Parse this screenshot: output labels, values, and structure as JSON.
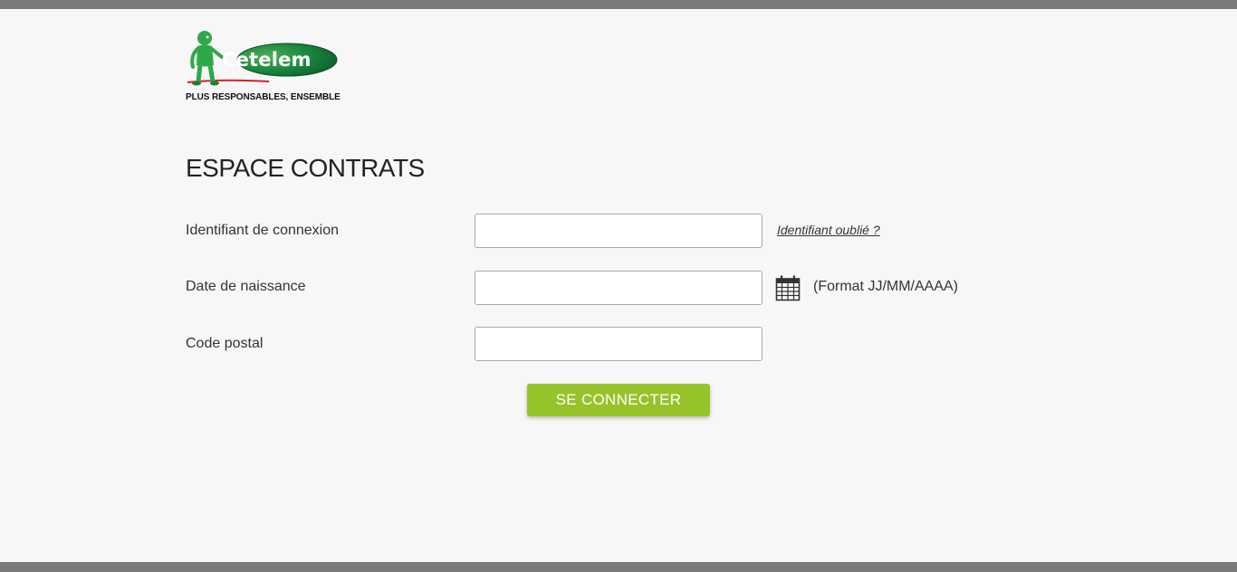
{
  "brand": {
    "name": "Cetelem",
    "tagline": "PLUS RESPONSABLES, ENSEMBLE",
    "logo_green": "#1a8a3c",
    "logo_dark_green": "#0d5e2e"
  },
  "page": {
    "title": "ESPACE CONTRATS"
  },
  "form": {
    "login_id": {
      "label": "Identifiant de connexion",
      "value": "",
      "forgot_link": "Identifiant oublié ?"
    },
    "birth_date": {
      "label": "Date de naissance",
      "value": "",
      "format_hint": "(Format JJ/MM/AAAA)",
      "icon": "calendar-icon"
    },
    "postal_code": {
      "label": "Code postal",
      "value": ""
    },
    "submit_label": "SE CONNECTER"
  },
  "colors": {
    "background": "#f7f7f7",
    "bars": "#7a7a7a",
    "button": "#97c32a",
    "text": "#333333"
  }
}
